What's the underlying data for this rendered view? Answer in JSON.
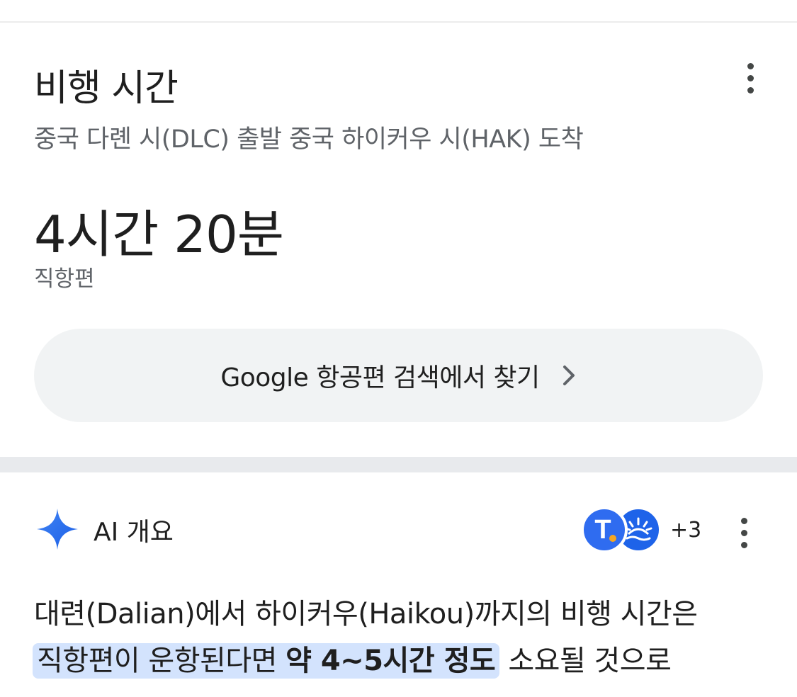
{
  "flight_card": {
    "title": "비행 시간",
    "route": "중국 다롄 시(DLC) 출발 중국 하이커우 시(HAK) 도착",
    "duration": "4시간 20분",
    "flight_type": "직항편",
    "google_flights_button": "Google 항공편 검색에서 찾기"
  },
  "ai_overview": {
    "title": "AI 개요",
    "source_t_letter": "T",
    "sources_more": "+3",
    "text_line1": "대련(Dalian)에서 하이커우(Haikou)까지의 비행 시간은",
    "highlight_part1": "직항편이 운항된다면 ",
    "highlight_bold": "약 4~5시간 정도",
    "text_after": " 소요될 것으로"
  },
  "icons": {
    "more": "more-vert-icon",
    "chevron": "chevron-right-icon",
    "ai": "sparkle-icon"
  },
  "colors": {
    "accent_blue": "#1a73e8",
    "highlight": "#d3e3fd",
    "button_bg": "#f1f3f4"
  }
}
